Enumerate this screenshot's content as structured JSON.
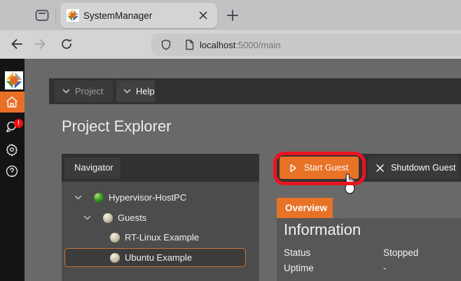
{
  "browser": {
    "tab_title": "SystemManager",
    "url_host": "localhost",
    "url_rest": ":5000/main"
  },
  "app": {
    "menubar": {
      "project": "Project",
      "help": "Help"
    },
    "page_title": "Project Explorer",
    "navigator": {
      "header": "Navigator",
      "tree": [
        {
          "label": "Hypervisor-HostPC",
          "icon": "green-orb",
          "expanded": true
        },
        {
          "label": "Guests",
          "icon": "beige-orb",
          "expanded": true
        },
        {
          "label": "RT-Linux Example",
          "icon": "beige-orb"
        },
        {
          "label": "Ubuntu Example",
          "icon": "beige-orb",
          "selected": true
        }
      ]
    },
    "actions": {
      "start": "Start Guest",
      "shutdown": "Shutdown Guest"
    },
    "tabs": {
      "overview": "Overview"
    },
    "info": {
      "heading": "Information",
      "rows": [
        {
          "label": "Status",
          "value": "Stopped"
        },
        {
          "label": "Uptime",
          "value": "-"
        }
      ]
    },
    "badge": {
      "notifications": "!"
    },
    "colors": {
      "accent": "#e87226",
      "highlight_ring": "#ea1420"
    }
  }
}
